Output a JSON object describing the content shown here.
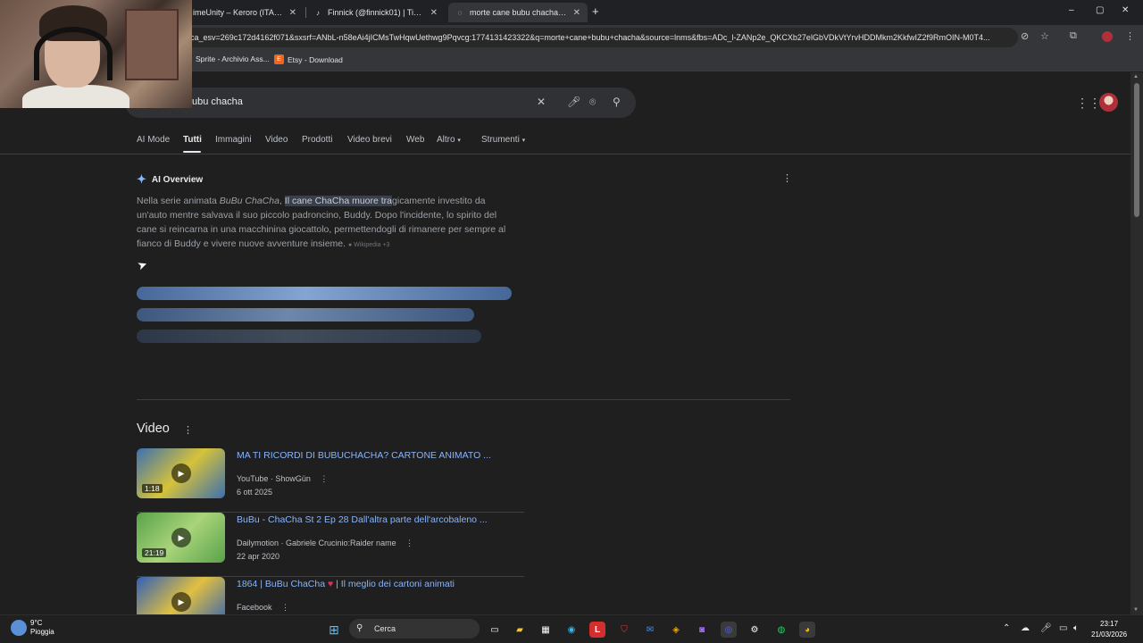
{
  "browser": {
    "tabs": [
      {
        "label": "imeUnity – Keroro (ITA) Stre",
        "icon": "play-icon"
      },
      {
        "label": "Finnick (@finnick01) | TikTok",
        "icon": "tiktok-icon"
      },
      {
        "label": "morte cane bubu chacha - Cerc",
        "icon": "google-icon"
      }
    ],
    "new_tab": "+",
    "window_controls": {
      "minimize": "–",
      "maximize": "▢",
      "close": "✕"
    },
    "url": "ca_esv=269c172d4162f071&sxsrf=ANbL-n58eAi4jICMsTwHqwUethwg9Pqvcg:1774131423322&q=morte+cane+bubu+chacha&source=lnms&fbs=ADc_l-ZANp2e_QKCXb27elGbVDkVtYrvHDDMkm2KkfwIZ2f9RmOIN-M0T4...",
    "bookmarks": [
      {
        "label": "Sprite - Archivio Ass...",
        "color": "#5a5a5a"
      },
      {
        "label": "Etsy - Download",
        "color": "#f1641e"
      }
    ]
  },
  "search": {
    "query": "ubu chacha",
    "tabs": [
      "AI Mode",
      "Tutti",
      "Immagini",
      "Video",
      "Prodotti",
      "Video brevi",
      "Web",
      "Altro",
      "Strumenti"
    ],
    "active_tab": "Tutti",
    "chevron": "▾"
  },
  "ai_overview": {
    "title": "AI Overview",
    "text_pre": "Nella serie animata ",
    "text_italic": "BuBu ChaCha",
    "text_mid": ", ",
    "text_highlight": "Il cane ChaCha muore tra",
    "text_post": "gicamente investito da un'auto mentre salvava il suo piccolo padroncino, Buddy. Dopo l'incidente, lo spirito del cane si reincarna in una macchinina giocattolo, permettendogli di rimanere per sempre al fianco di Buddy e vivere nuove avventure insieme.",
    "source": "Wikipedia +3",
    "loading_bars": [
      {
        "level": 1.0,
        "opacity": 0.9
      },
      {
        "level": 0.9,
        "opacity": 0.7
      },
      {
        "level": 0.92,
        "opacity": 0.3
      }
    ]
  },
  "videos": {
    "heading": "Video",
    "items": [
      {
        "title": "MA TI RICORDI DI BUBUCHACHA? CARTONE ANIMATO ...",
        "source": "YouTube · ShowGün",
        "date": "6 ott 2025",
        "duration": "1:18",
        "thumb_a": "#3b6fb0",
        "thumb_b": "#d6c23a"
      },
      {
        "title": "BuBu - ChaCha St 2 Ep 28 Dall'altra parte dell'arcobaleno ...",
        "source": "Dailymotion · Gabriele Crucinio:Raider name",
        "date": "22 apr 2020",
        "duration": "21:19",
        "thumb_a": "#5aa24a",
        "thumb_b": "#a8d47a"
      },
      {
        "title_pre": "1864 | BuBu ChaCha ",
        "title_heart": "♥",
        "title_post": " | Il meglio dei cartoni animati",
        "source": "Facebook",
        "date": "",
        "duration": "",
        "thumb_a": "#2f5fb8",
        "thumb_b": "#e0c040"
      }
    ]
  },
  "taskbar": {
    "weather_temp": "9°C",
    "weather_desc": "Pioggia",
    "search_label": "Cerca",
    "time": "23:17",
    "date": "21/03/2026"
  },
  "colors": {
    "background": "#1f1f1f",
    "link": "#8ab4f8",
    "accent": "#8ab4f8"
  }
}
